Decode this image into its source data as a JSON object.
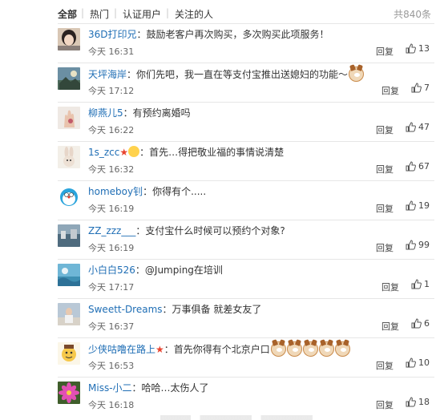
{
  "filter": {
    "tabs": [
      "全部",
      "热门",
      "认证用户",
      "关注的人"
    ],
    "total": "共840条"
  },
  "comments": [
    {
      "user": "36D打印兄",
      "text": "：鼓励老客户再次购买，多次购买此项服务！",
      "time": "今天 16:31",
      "reply": "回复",
      "likes": "13"
    },
    {
      "user": "天坪海岸",
      "text": "：你们先吧，我一直在等支付宝推出送媳妇的功能～",
      "time": "今天 17:12",
      "reply": "回复",
      "likes": "7"
    },
    {
      "user": "柳燕儿5",
      "text": "：有预约离婚吗",
      "time": "今天 16:22",
      "reply": "回复",
      "likes": "47"
    },
    {
      "user": "1s_zcc",
      "text": "：首先…得把敬业福的事情说清楚",
      "time": "今天 16:32",
      "reply": "回复",
      "likes": "67"
    },
    {
      "user": "homeboy钊",
      "text": "：你得有个.....",
      "time": "今天 16:19",
      "reply": "回复",
      "likes": "19"
    },
    {
      "user": "ZZ_zzz___",
      "text": "：支付宝什么时候可以预约个对象?",
      "time": "今天 16:19",
      "reply": "回复",
      "likes": "99"
    },
    {
      "user": "小白白526",
      "text": "：@Jumping在培训",
      "time": "今天 17:17",
      "reply": "回复",
      "likes": "1"
    },
    {
      "user": "Sweett-Dreams",
      "text": "：万事俱备  就差女友了",
      "time": "今天 16:37",
      "reply": "回复",
      "likes": "6"
    },
    {
      "user": "少侠咕噜在路上",
      "text": "：首先你得有个北京户口",
      "time": "今天 16:53",
      "reply": "回复",
      "likes": "10"
    },
    {
      "user": "Miss-小二",
      "text": "：哈哈…太伤人了",
      "time": "今天 16:18",
      "reply": "回复",
      "likes": "18"
    }
  ]
}
